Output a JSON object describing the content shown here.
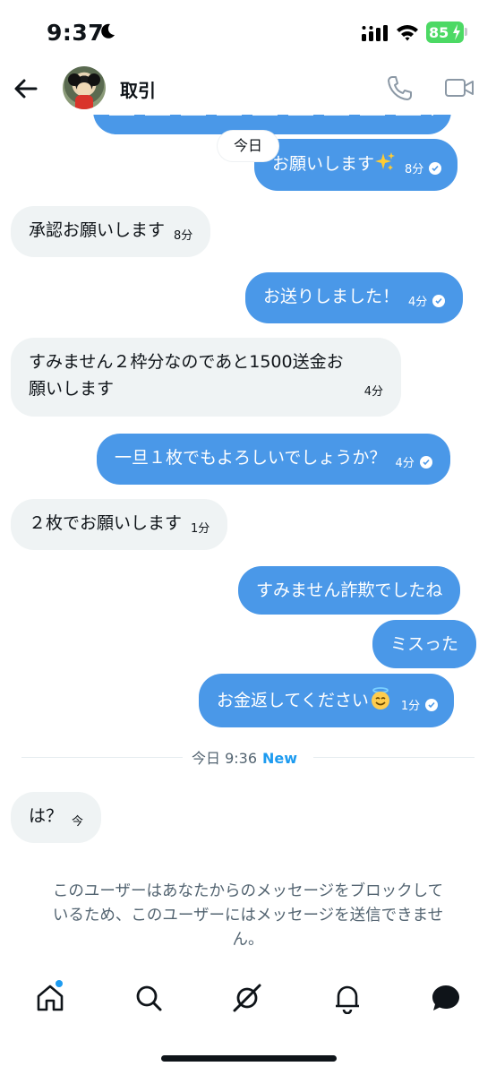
{
  "status_bar": {
    "time": "9:37",
    "battery": "85"
  },
  "header": {
    "title": "取引",
    "back_icon": "arrow-left-icon",
    "call_icon": "phone-icon",
    "video_icon": "video-icon"
  },
  "date_chip": "今日",
  "messages": [
    {
      "dir": "out",
      "text": "お願いします",
      "emoji": "sparkles",
      "time": "8分",
      "read": true
    },
    {
      "dir": "in",
      "text": "承認お願いします",
      "time": "8分"
    },
    {
      "dir": "out",
      "text": "お送りしました！",
      "time": "4分",
      "read": true
    },
    {
      "dir": "in",
      "line1": "すみません２枠分なのであと1500送金お",
      "line2": "願いします",
      "time": "4分"
    },
    {
      "dir": "out",
      "text": "一旦１枚でもよろしいでしょうか？",
      "time": "4分",
      "read": true
    },
    {
      "dir": "in",
      "text": "２枚でお願いします",
      "time": "1分"
    },
    {
      "dir": "out",
      "text": "すみません詐欺でしたね"
    },
    {
      "dir": "out",
      "text": "ミスった"
    },
    {
      "dir": "out",
      "text": "お金返してください",
      "emoji": "smiling-face-with-halo",
      "time": "1分",
      "read": true
    },
    {
      "dir": "in",
      "text": "は？",
      "time": "今"
    }
  ],
  "divider": {
    "label": "今日 9:36",
    "new_label": "New"
  },
  "blocked_notice": {
    "line1": "このユーザーはあなたからのメッセージをブロックして",
    "line2": "いるため、このユーザーにはメッセージを送信できませ",
    "line3": "ん。"
  },
  "tabs": [
    "home-icon",
    "search-icon",
    "grok-icon",
    "bell-icon",
    "messages-icon"
  ],
  "colors": {
    "outgoing_bubble": "#4a98e8",
    "incoming_bubble": "#eff3f4",
    "accent": "#1d9bf0",
    "battery": "#4cd964"
  }
}
